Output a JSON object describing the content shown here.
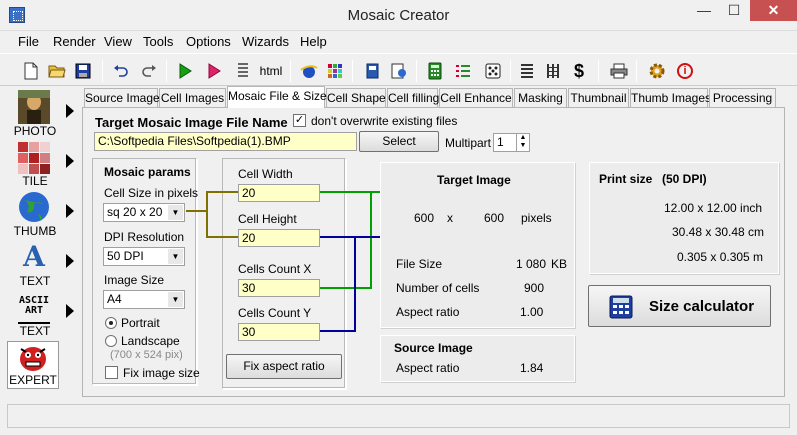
{
  "window": {
    "title": "Mosaic Creator",
    "minimize": "—",
    "maximize": "☐",
    "close": "✕"
  },
  "menu": [
    "File",
    "Render",
    "View",
    "Tools",
    "Options",
    "Wizards",
    "Help"
  ],
  "toolbar": {
    "html_label": "html",
    "dollar": "$",
    "info": "i"
  },
  "sidebar": [
    {
      "label": "PHOTO"
    },
    {
      "label": "TILE"
    },
    {
      "label": "THUMB"
    },
    {
      "label": "TEXT",
      "glyph": "A"
    },
    {
      "label": "TEXT",
      "glyph": "ASCII ART"
    },
    {
      "label": "EXPERT"
    }
  ],
  "tabs": [
    "Source Image",
    "Cell Images",
    "Mosaic File & Size",
    "Cell Shape",
    "Cell filling",
    "Cell Enhance",
    "Masking",
    "Thumbnail",
    "Thumb Images",
    "Processing"
  ],
  "active_tab": "Mosaic File & Size",
  "target_file": {
    "heading": "Target Mosaic Image File Name",
    "dont_overwrite": "don't overwrite existing files",
    "dont_overwrite_checked": true,
    "path": "C:\\Softpedia Files\\Softpedia(1).BMP",
    "select": "Select",
    "multipart_label": "Multipart",
    "multipart_value": "1"
  },
  "mosaic_params": {
    "heading": "Mosaic params",
    "cell_size_label": "Cell Size in pixels",
    "cell_size_value": "sq 20 x 20",
    "dpi_label": "DPI Resolution",
    "dpi_value": "50 DPI",
    "image_size_label": "Image Size",
    "image_size_value": "A4",
    "portrait": "Portrait",
    "landscape": "Landscape",
    "landscape_dims": "(700 x 524 pix)",
    "orientation": "Portrait",
    "fix_image_size": "Fix image size",
    "fix_image_size_checked": false
  },
  "cells": {
    "cell_width_label": "Cell Width",
    "cell_width": "20",
    "cell_height_label": "Cell Height",
    "cell_height": "20",
    "count_x_label": "Cells Count X",
    "count_x": "30",
    "count_y_label": "Cells Count Y",
    "count_y": "30",
    "fix_aspect": "Fix aspect ratio"
  },
  "target_image": {
    "heading": "Target Image",
    "width": "600",
    "x": "x",
    "height": "600",
    "unit": "pixels",
    "file_size_label": "File Size",
    "file_size_value": "1 080",
    "file_size_unit": "KB",
    "cells_label": "Number of cells",
    "cells_value": "900",
    "aspect_label": "Aspect ratio",
    "aspect_value": "1.00"
  },
  "source_image": {
    "heading": "Source Image",
    "aspect_label": "Aspect ratio",
    "aspect_value": "1.84"
  },
  "print_size": {
    "heading": "Print size",
    "dpi": "(50 DPI)",
    "inch": "12.00 x  12.00 inch",
    "cm": "30.48 x  30.48 cm",
    "m": "0.305 x  0.305 m"
  },
  "size_calculator": "Size calculator",
  "colors": {
    "connector_olive": "#807000",
    "connector_green": "#00a000",
    "connector_navy": "#00009c",
    "field_yellow": "#ffffc8",
    "close_red": "#c75050"
  }
}
